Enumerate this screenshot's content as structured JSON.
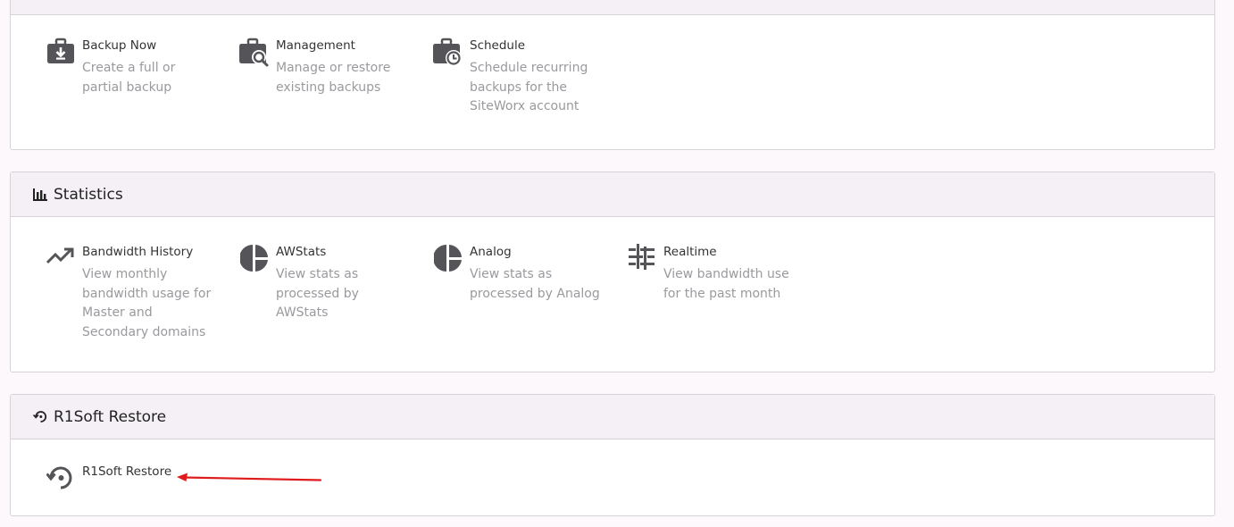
{
  "backup": {
    "items": [
      {
        "label": "Backup Now",
        "desc": "Create a full or partial backup",
        "icon": "briefcase-download-icon"
      },
      {
        "label": "Management",
        "desc": "Manage or restore existing backups",
        "icon": "briefcase-search-icon"
      },
      {
        "label": "Schedule",
        "desc": "Schedule recurring backups for the SiteWorx account",
        "icon": "briefcase-clock-icon"
      }
    ]
  },
  "statistics": {
    "title": "Statistics",
    "icon": "bar-chart-icon",
    "items": [
      {
        "label": "Bandwidth History",
        "desc": "View monthly bandwidth usage for Master and Secondary domains",
        "icon": "trending-up-icon"
      },
      {
        "label": "AWStats",
        "desc": "View stats as processed by AWStats",
        "icon": "pie-chart-icon"
      },
      {
        "label": "Analog",
        "desc": "View stats as processed by Analog",
        "icon": "pie-chart-icon"
      },
      {
        "label": "Realtime",
        "desc": "View bandwidth use for the past month",
        "icon": "realtime-icon"
      }
    ]
  },
  "r1soft": {
    "title": "R1Soft Restore",
    "icon": "history-icon",
    "items": [
      {
        "label": "R1Soft Restore",
        "icon": "history-icon"
      }
    ]
  },
  "colors": {
    "icon": "#555459",
    "annotation_arrow": "#e01b1b"
  }
}
